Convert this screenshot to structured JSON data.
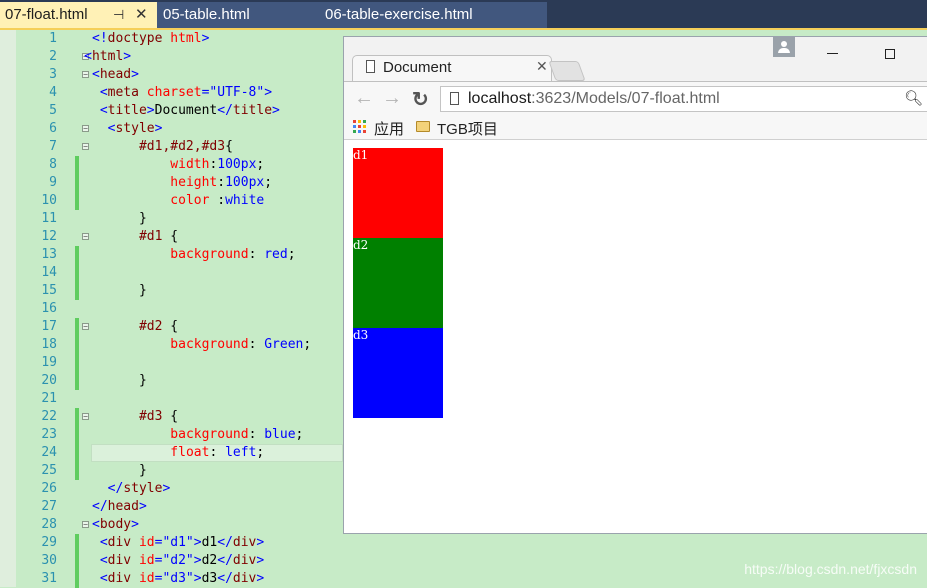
{
  "editor": {
    "tabs": [
      {
        "label": "07-float.html",
        "active": true
      },
      {
        "label": "05-table.html",
        "active": false
      },
      {
        "label": "06-table-exercise.html",
        "active": false
      }
    ],
    "lines": [
      {
        "n": "1",
        "indent": 0,
        "fold": "",
        "chg": false,
        "segs": [
          [
            "p",
            "<!"
          ],
          [
            "t",
            "doctype"
          ],
          [
            "k",
            " "
          ],
          [
            "a",
            "html"
          ],
          [
            "p",
            ">"
          ]
        ]
      },
      {
        "n": "2",
        "indent": -1,
        "fold": "-",
        "chg": false,
        "segs": [
          [
            "p",
            "<"
          ],
          [
            "t",
            "html"
          ],
          [
            "p",
            ">"
          ]
        ]
      },
      {
        "n": "3",
        "indent": 0,
        "fold": "-",
        "chg": false,
        "segs": [
          [
            "p",
            "<"
          ],
          [
            "t",
            "head"
          ],
          [
            "p",
            ">"
          ]
        ]
      },
      {
        "n": "4",
        "indent": 1,
        "fold": "",
        "chg": false,
        "segs": [
          [
            "p",
            "<"
          ],
          [
            "t",
            "meta"
          ],
          [
            "k",
            " "
          ],
          [
            "a",
            "charset"
          ],
          [
            "p",
            "=\"UTF-8\">"
          ]
        ]
      },
      {
        "n": "5",
        "indent": 1,
        "fold": "",
        "chg": false,
        "segs": [
          [
            "p",
            "<"
          ],
          [
            "t",
            "title"
          ],
          [
            "p",
            ">"
          ],
          [
            "k",
            "Document"
          ],
          [
            "p",
            "</"
          ],
          [
            "t",
            "title"
          ],
          [
            "p",
            ">"
          ]
        ]
      },
      {
        "n": "6",
        "indent": 2,
        "fold": "-",
        "chg": false,
        "segs": [
          [
            "p",
            "<"
          ],
          [
            "t",
            "style"
          ],
          [
            "p",
            ">"
          ]
        ]
      },
      {
        "n": "7",
        "indent": 6,
        "fold": "-",
        "chg": false,
        "segs": [
          [
            "t",
            "#d1,#d2,#d3"
          ],
          [
            "k",
            "{"
          ]
        ]
      },
      {
        "n": "8",
        "indent": 10,
        "fold": "",
        "chg": true,
        "segs": [
          [
            "a",
            "width"
          ],
          [
            "k",
            ":"
          ],
          [
            "p",
            "100px"
          ],
          [
            "k",
            ";"
          ]
        ]
      },
      {
        "n": "9",
        "indent": 10,
        "fold": "",
        "chg": true,
        "segs": [
          [
            "a",
            "height"
          ],
          [
            "k",
            ":"
          ],
          [
            "p",
            "100px"
          ],
          [
            "k",
            ";"
          ]
        ]
      },
      {
        "n": "10",
        "indent": 10,
        "fold": "",
        "chg": true,
        "segs": [
          [
            "a",
            "color"
          ],
          [
            "k",
            " :"
          ],
          [
            "p",
            "white"
          ]
        ]
      },
      {
        "n": "11",
        "indent": 6,
        "fold": "",
        "chg": false,
        "segs": [
          [
            "k",
            "}"
          ]
        ]
      },
      {
        "n": "12",
        "indent": 6,
        "fold": "-",
        "chg": false,
        "segs": [
          [
            "t",
            "#d1"
          ],
          [
            "k",
            " {"
          ]
        ]
      },
      {
        "n": "13",
        "indent": 10,
        "fold": "",
        "chg": true,
        "segs": [
          [
            "a",
            "background"
          ],
          [
            "k",
            ": "
          ],
          [
            "p",
            "red"
          ],
          [
            "k",
            ";"
          ]
        ]
      },
      {
        "n": "14",
        "indent": 0,
        "fold": "",
        "chg": true,
        "segs": []
      },
      {
        "n": "15",
        "indent": 6,
        "fold": "",
        "chg": true,
        "segs": [
          [
            "k",
            "}"
          ]
        ]
      },
      {
        "n": "16",
        "indent": 0,
        "fold": "",
        "chg": false,
        "segs": []
      },
      {
        "n": "17",
        "indent": 6,
        "fold": "-",
        "chg": true,
        "segs": [
          [
            "t",
            "#d2"
          ],
          [
            "k",
            " {"
          ]
        ]
      },
      {
        "n": "18",
        "indent": 10,
        "fold": "",
        "chg": true,
        "segs": [
          [
            "a",
            "background"
          ],
          [
            "k",
            ": "
          ],
          [
            "p",
            "Green"
          ],
          [
            "k",
            ";"
          ]
        ]
      },
      {
        "n": "19",
        "indent": 0,
        "fold": "",
        "chg": true,
        "segs": []
      },
      {
        "n": "20",
        "indent": 6,
        "fold": "",
        "chg": true,
        "segs": [
          [
            "k",
            "}"
          ]
        ]
      },
      {
        "n": "21",
        "indent": 0,
        "fold": "",
        "chg": false,
        "segs": []
      },
      {
        "n": "22",
        "indent": 6,
        "fold": "-",
        "chg": true,
        "segs": [
          [
            "t",
            "#d3"
          ],
          [
            "k",
            " {"
          ]
        ]
      },
      {
        "n": "23",
        "indent": 10,
        "fold": "",
        "chg": true,
        "segs": [
          [
            "a",
            "background"
          ],
          [
            "k",
            ": "
          ],
          [
            "p",
            "blue"
          ],
          [
            "k",
            ";"
          ]
        ]
      },
      {
        "n": "24",
        "indent": 10,
        "fold": "",
        "chg": true,
        "current": true,
        "segs": [
          [
            "a",
            "float"
          ],
          [
            "k",
            ": "
          ],
          [
            "p",
            "left"
          ],
          [
            "k",
            ";"
          ]
        ]
      },
      {
        "n": "25",
        "indent": 6,
        "fold": "",
        "chg": true,
        "segs": [
          [
            "k",
            "}"
          ]
        ]
      },
      {
        "n": "26",
        "indent": 2,
        "fold": "",
        "chg": false,
        "segs": [
          [
            "p",
            "</"
          ],
          [
            "t",
            "style"
          ],
          [
            "p",
            ">"
          ]
        ]
      },
      {
        "n": "27",
        "indent": 0,
        "fold": "",
        "chg": false,
        "segs": [
          [
            "p",
            "</"
          ],
          [
            "t",
            "head"
          ],
          [
            "p",
            ">"
          ]
        ]
      },
      {
        "n": "28",
        "indent": 0,
        "fold": "-",
        "chg": false,
        "segs": [
          [
            "p",
            "<"
          ],
          [
            "t",
            "body"
          ],
          [
            "p",
            ">"
          ]
        ]
      },
      {
        "n": "29",
        "indent": 1,
        "fold": "",
        "chg": true,
        "segs": [
          [
            "p",
            "<"
          ],
          [
            "t",
            "div"
          ],
          [
            "k",
            " "
          ],
          [
            "a",
            "id"
          ],
          [
            "p",
            "=\"d1\">"
          ],
          [
            "k",
            "d1"
          ],
          [
            "p",
            "</"
          ],
          [
            "t",
            "div"
          ],
          [
            "p",
            ">"
          ]
        ]
      },
      {
        "n": "30",
        "indent": 1,
        "fold": "",
        "chg": true,
        "segs": [
          [
            "p",
            "<"
          ],
          [
            "t",
            "div"
          ],
          [
            "k",
            " "
          ],
          [
            "a",
            "id"
          ],
          [
            "p",
            "=\"d2\">"
          ],
          [
            "k",
            "d2"
          ],
          [
            "p",
            "</"
          ],
          [
            "t",
            "div"
          ],
          [
            "p",
            ">"
          ]
        ]
      },
      {
        "n": "31",
        "indent": 1,
        "fold": "",
        "chg": true,
        "segs": [
          [
            "p",
            "<"
          ],
          [
            "t",
            "div"
          ],
          [
            "k",
            " "
          ],
          [
            "a",
            "id"
          ],
          [
            "p",
            "=\"d3\">"
          ],
          [
            "k",
            "d3"
          ],
          [
            "p",
            "</"
          ],
          [
            "t",
            "div"
          ],
          [
            "p",
            ">"
          ]
        ]
      }
    ]
  },
  "browser": {
    "tab_title": "Document",
    "url_host": "localhost",
    "url_rest": ":3623/Models/07-float.html",
    "bookmarks": [
      {
        "label": "应用",
        "icon": "apps-icon"
      },
      {
        "label": "TGB项目",
        "icon": "folder-icon"
      }
    ],
    "boxes": [
      {
        "id": "d1",
        "text": "d1",
        "color": "#ff0000"
      },
      {
        "id": "d2",
        "text": "d2",
        "color": "#008000"
      },
      {
        "id": "d3",
        "text": "d3",
        "color": "#0000ff"
      }
    ]
  },
  "watermark": "https://blog.csdn.net/fjxcsdn"
}
